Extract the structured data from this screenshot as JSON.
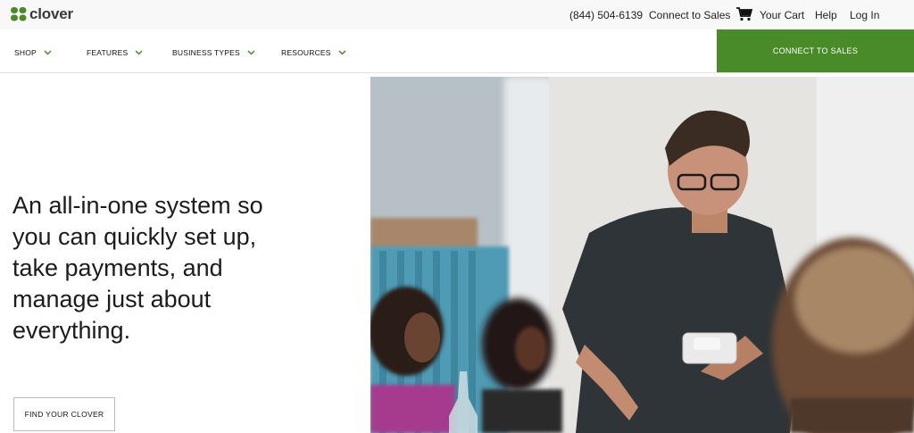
{
  "brand": {
    "name": "clover",
    "color": "#4a8b29"
  },
  "topbar": {
    "phone": "(844) 504-6139",
    "connect_link": "Connect to Sales",
    "cart_label": "Your Cart",
    "help": "Help",
    "login": "Log In"
  },
  "nav": {
    "items": [
      {
        "label": "SHOP"
      },
      {
        "label": "FEATURES"
      },
      {
        "label": "BUSINESS TYPES"
      },
      {
        "label": "RESOURCES"
      }
    ],
    "cta": "CONNECT TO SALES"
  },
  "hero": {
    "headline": "An all-in-one system so you can quickly set up, take payments, and manage just about everything.",
    "button": "FIND YOUR CLOVER",
    "image_icon": "hero-photo-server-with-card-reader"
  }
}
